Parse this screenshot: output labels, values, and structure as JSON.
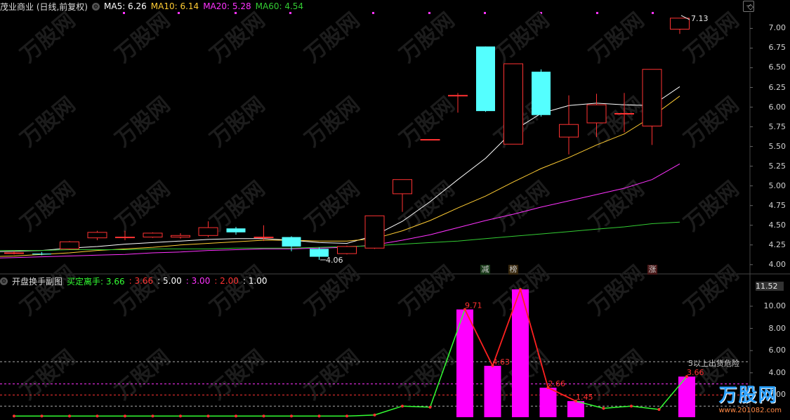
{
  "main_header": {
    "title": "茂业商业 (日线,前复权)",
    "ma5": "MA5: 6.26",
    "ma10": "MA10: 6.14",
    "ma20": "MA20: 5.28",
    "ma60": "MA60: 4.54"
  },
  "sub_header": {
    "title": "开盘换手副图",
    "indicator": "买定离手: 3.66",
    "v1": ": 3.66",
    "v2": ": 5.00",
    "v3": ": 3.00",
    "v4": ": 2.00",
    "v5": ": 1.00"
  },
  "colors": {
    "up": "#ff3232",
    "down": "#54ffff",
    "ma5": "#ffffff",
    "ma10": "#ffcc33",
    "ma20": "#ff33ff",
    "ma60": "#33cc33",
    "bar": "#ff00ff"
  },
  "signals": [
    {
      "label": "减",
      "color": "#33ff33"
    },
    {
      "label": "榜",
      "color": "#ffcc33"
    },
    {
      "label": "涨",
      "color": "#ff6666"
    }
  ],
  "price_annotations": {
    "high": "7.13",
    "low": "4.06"
  },
  "sub_annotations": {
    "top": "11.52",
    "danger": "5以上出货危险"
  },
  "watermark": {
    "brand": "万股网",
    "url": "www.201082.com"
  },
  "chart_data": [
    {
      "type": "candlestick",
      "title": "茂业商业 (日线,前复权)",
      "ylim": [
        3.9,
        7.2
      ],
      "yticks": [
        4.0,
        4.25,
        4.5,
        4.75,
        5.0,
        5.25,
        5.5,
        5.75,
        6.0,
        6.25,
        6.5,
        6.75,
        7.0
      ],
      "candles": [
        {
          "o": 4.15,
          "c": 4.15,
          "h": 4.17,
          "l": 4.13
        },
        {
          "o": 4.14,
          "c": 4.13,
          "h": 4.16,
          "l": 4.12
        },
        {
          "o": 4.2,
          "c": 4.29,
          "h": 4.3,
          "l": 4.19
        },
        {
          "o": 4.34,
          "c": 4.41,
          "h": 4.43,
          "l": 4.31
        },
        {
          "o": 4.35,
          "c": 4.35,
          "h": 4.43,
          "l": 4.31
        },
        {
          "o": 4.35,
          "c": 4.4,
          "h": 4.41,
          "l": 4.34
        },
        {
          "o": 4.35,
          "c": 4.37,
          "h": 4.4,
          "l": 4.33
        },
        {
          "o": 4.37,
          "c": 4.47,
          "h": 4.55,
          "l": 4.35
        },
        {
          "o": 4.46,
          "c": 4.41,
          "h": 4.48,
          "l": 4.38
        },
        {
          "o": 4.35,
          "c": 4.35,
          "h": 4.5,
          "l": 4.3
        },
        {
          "o": 4.35,
          "c": 4.23,
          "h": 4.36,
          "l": 4.17
        },
        {
          "o": 4.2,
          "c": 4.1,
          "h": 4.22,
          "l": 4.06
        },
        {
          "o": 4.14,
          "c": 4.23,
          "h": 4.24,
          "l": 4.13
        },
        {
          "o": 4.21,
          "c": 4.62,
          "h": 4.62,
          "l": 4.2
        },
        {
          "o": 4.9,
          "c": 5.08,
          "h": 5.08,
          "l": 4.67
        },
        {
          "o": 5.59,
          "c": 5.59,
          "h": 5.59,
          "l": 5.59
        },
        {
          "o": 6.15,
          "c": 6.15,
          "h": 6.18,
          "l": 5.93
        },
        {
          "o": 6.77,
          "c": 5.95,
          "h": 6.77,
          "l": 5.94
        },
        {
          "o": 5.53,
          "c": 6.55,
          "h": 6.55,
          "l": 5.53
        },
        {
          "o": 6.45,
          "c": 5.9,
          "h": 6.48,
          "l": 5.88
        },
        {
          "o": 5.62,
          "c": 5.78,
          "h": 6.15,
          "l": 5.4
        },
        {
          "o": 5.8,
          "c": 6.03,
          "h": 6.17,
          "l": 5.62
        },
        {
          "o": 5.92,
          "c": 5.92,
          "h": 6.18,
          "l": 5.68
        },
        {
          "o": 5.76,
          "c": 6.48,
          "h": 6.48,
          "l": 5.52
        },
        {
          "o": 6.99,
          "c": 7.13,
          "h": 7.13,
          "l": 6.93
        }
      ],
      "series": [
        {
          "name": "MA5",
          "values": [
            4.16,
            4.17,
            4.18,
            4.21,
            4.23,
            4.26,
            4.28,
            4.3,
            4.32,
            4.33,
            4.33,
            4.31,
            4.28,
            4.27,
            4.37,
            4.55,
            4.8,
            5.08,
            5.35,
            5.7,
            5.92,
            6.02,
            6.05,
            6.03,
            6.02,
            6.26
          ]
        },
        {
          "name": "MA10",
          "values": [
            4.1,
            4.11,
            4.13,
            4.15,
            4.18,
            4.2,
            4.22,
            4.25,
            4.27,
            4.29,
            4.31,
            4.31,
            4.3,
            4.3,
            4.33,
            4.43,
            4.56,
            4.72,
            4.87,
            5.05,
            5.22,
            5.36,
            5.52,
            5.66,
            5.88,
            6.14
          ]
        },
        {
          "name": "MA20",
          "values": [
            4.08,
            4.09,
            4.1,
            4.11,
            4.12,
            4.13,
            4.15,
            4.16,
            4.18,
            4.19,
            4.2,
            4.2,
            4.21,
            4.22,
            4.25,
            4.31,
            4.38,
            4.47,
            4.56,
            4.64,
            4.73,
            4.81,
            4.89,
            4.97,
            5.08,
            5.28
          ]
        },
        {
          "name": "MA60",
          "values": [
            4.18,
            4.18,
            4.18,
            4.19,
            4.19,
            4.19,
            4.2,
            4.2,
            4.2,
            4.21,
            4.21,
            4.21,
            4.22,
            4.23,
            4.24,
            4.26,
            4.28,
            4.3,
            4.33,
            4.36,
            4.39,
            4.42,
            4.45,
            4.48,
            4.52,
            4.54
          ]
        }
      ]
    },
    {
      "type": "bar",
      "title": "开盘换手副图",
      "ylim": [
        0,
        11.52
      ],
      "yticks": [
        2.0,
        4.0,
        6.0,
        8.0,
        10.0
      ],
      "values": [
        0,
        0,
        0,
        0,
        0,
        0,
        0,
        0,
        0,
        0,
        0,
        0,
        0,
        0,
        0,
        0,
        9.71,
        4.63,
        11.52,
        2.66,
        1.45,
        0,
        0,
        0,
        3.66
      ],
      "labels": [
        "",
        "",
        "",
        "",
        "",
        "",
        "",
        "",
        "",
        "",
        "",
        "",
        "",
        "",
        "",
        "",
        "9.71",
        "4.63",
        "",
        "2.66",
        "1.45",
        "",
        "",
        "",
        "3.66"
      ],
      "line": [
        0.1,
        0.1,
        0.1,
        0.1,
        0.1,
        0.1,
        0.1,
        0.1,
        0.1,
        0.1,
        0.1,
        0.1,
        0.1,
        0.2,
        1.0,
        0.9,
        9.71,
        4.63,
        11.52,
        2.66,
        1.45,
        0.8,
        1.0,
        0.7,
        3.66
      ],
      "hlines": [
        5.0,
        3.0,
        2.0,
        1.0
      ]
    }
  ]
}
